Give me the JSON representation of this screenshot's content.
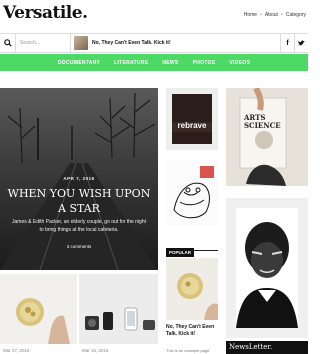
{
  "header": {
    "logo": "Versatile.",
    "nav": [
      "Home",
      "About",
      "Category"
    ]
  },
  "searchbar": {
    "placeholder": "Search...",
    "headline": "No, They Can't Even Talk. Kick it!",
    "social": [
      "f",
      "y"
    ]
  },
  "menu": {
    "items": [
      "DOCUMENTARY",
      "LITERATURE",
      "NEWS",
      "PHOTOS",
      "VIDEOS"
    ]
  },
  "hero": {
    "date": "APR 7, 2016",
    "title": "WHEN YOU WISH UPON A STAR",
    "excerpt": "James & Edith Packer, an elderly couple, go out for the night to bring things at the local cafeteria.",
    "comments": "3 comments"
  },
  "cards": [
    {
      "date": "Mar 27, 2016"
    },
    {
      "date": "Mar 16, 2016"
    }
  ],
  "middle": {
    "ad_text": "rebrave",
    "popular_label": "POPULAR",
    "post_title": "No, They Can't Even Talk. Kick it!",
    "post_excerpt": "This is an example page."
  },
  "right": {
    "magazine_title": "ARTS SCIENCE",
    "newsletter_label": "NewsLetter."
  },
  "colors": {
    "accent": "#4cd964",
    "dark": "#111111"
  }
}
